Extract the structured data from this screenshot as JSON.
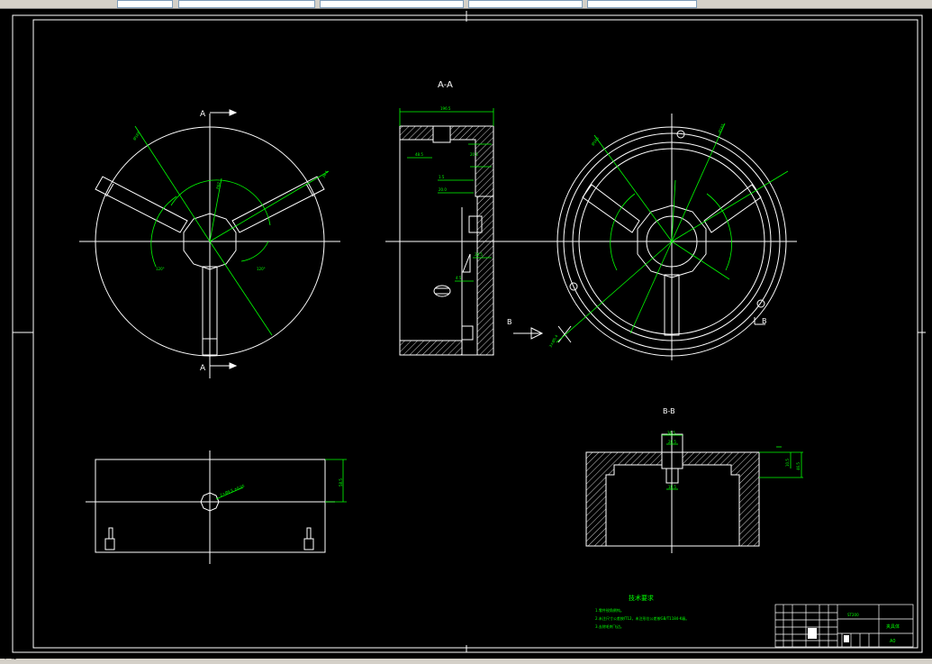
{
  "section_labels": {
    "aa": "A-A",
    "bb": "B-B",
    "cut_a_top": "A",
    "cut_a_bottom": "A",
    "cut_b_left": "B",
    "cut_b_right": "B"
  },
  "dimensions": {
    "aa_width": "196.5",
    "aa_d1": "48.5",
    "aa_d2": "20.5",
    "aa_d3": "1.5",
    "aa_d4": "20.0",
    "aa_d5": "28.5",
    "aa_d6": "4.5",
    "left_r1": "Ø165",
    "left_r2": "R62",
    "left_a1": "120°",
    "left_a2": "120°",
    "left_d1": "36.5",
    "right_r1": "Ø165",
    "right_r2": "Ø165",
    "right_d1": "3×Ø5.4",
    "bottom_hole": "2×Ø9.5 ±0.05",
    "bottom_h": "58.5",
    "bb_w1": "36.5",
    "bb_w2": "28.5",
    "bb_w3": "18.5",
    "bb_h1": "10.5",
    "bb_h2": "46.5"
  },
  "tech_requirements": {
    "title": "技术要求",
    "lines": [
      "1.零件锐角倒钝。",
      "2.未注尺寸公差按IT12，未注形位公差按GB/T1184-K级。",
      "3.去除毛刺飞边。"
    ]
  },
  "title_block": {
    "code": "ST200",
    "name": "夹具体",
    "sheet": "A0"
  },
  "status": {
    "text": "Y=43"
  },
  "colors": {
    "line": "#ffffff",
    "dim": "#00ff00",
    "bg": "#000000"
  }
}
